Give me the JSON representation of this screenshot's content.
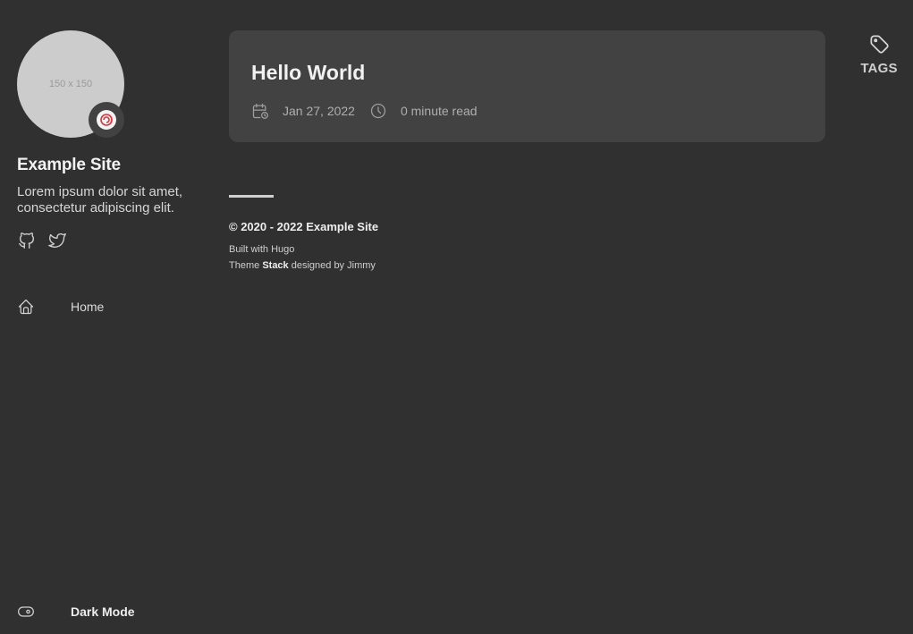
{
  "sidebar": {
    "avatar_placeholder": "150 x 150",
    "site_name": "Example Site",
    "site_description": "Lorem ipsum dolor sit amet, consectetur adipiscing elit.",
    "social": [
      {
        "icon": "github-icon"
      },
      {
        "icon": "twitter-icon"
      }
    ],
    "menu": [
      {
        "label": "Home",
        "icon": "home-icon"
      }
    ],
    "dark_mode_label": "Dark Mode"
  },
  "article": {
    "title": "Hello World",
    "date": "Jan 27, 2022",
    "read_time": "0 minute read"
  },
  "footer": {
    "copyright": "© 2020 - 2022 Example Site",
    "built_with_prefix": "Built with",
    "built_with_name": "Hugo",
    "theme_prefix": "Theme",
    "theme_name": "Stack",
    "theme_middle": "designed by",
    "theme_author": "Jimmy"
  },
  "widgets": {
    "tags_label": "TAGS"
  },
  "colors": {
    "background": "#303030",
    "card": "#424242",
    "text": "#e8e8e8"
  }
}
